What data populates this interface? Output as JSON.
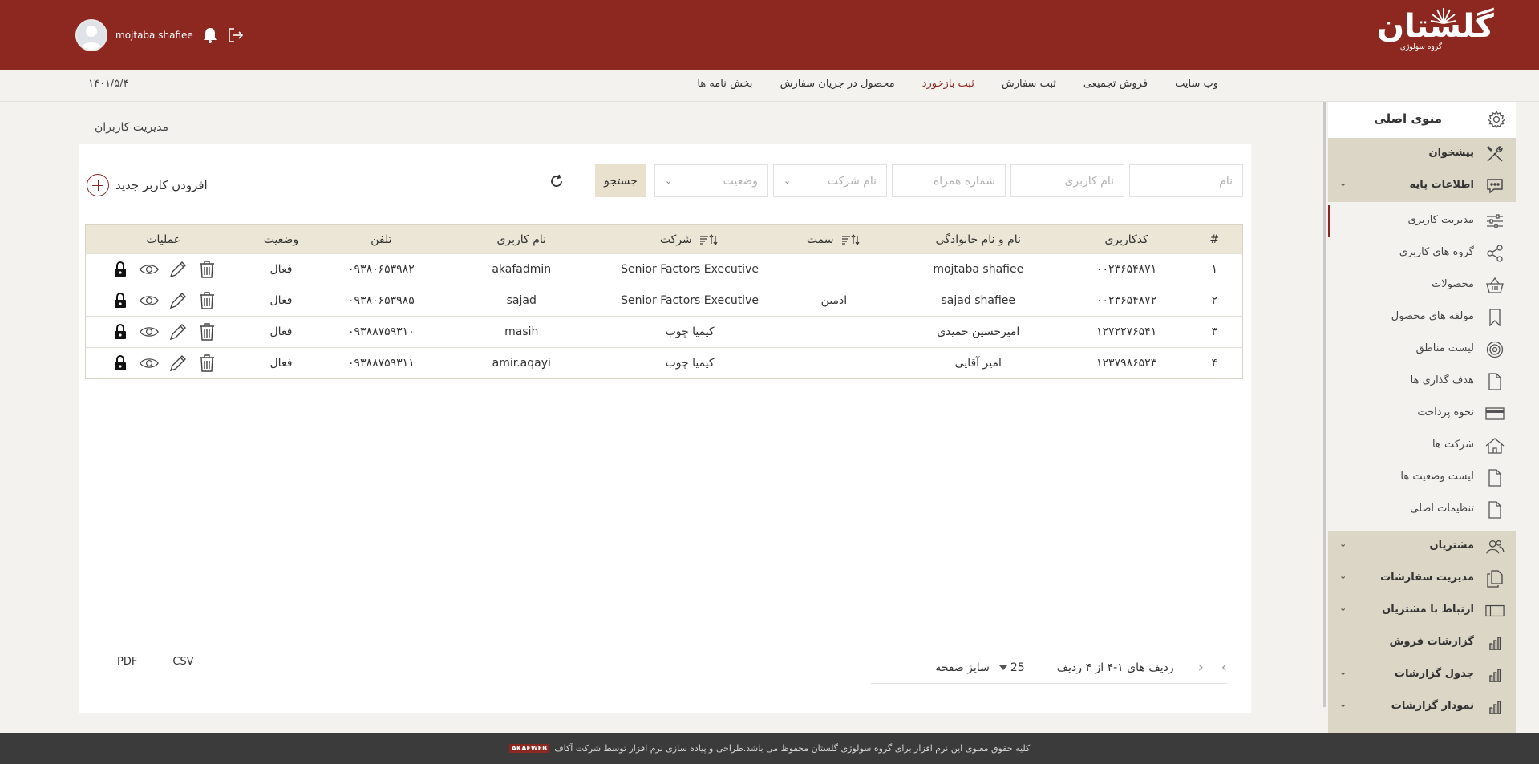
{
  "header": {
    "logo_text": "گلستان",
    "logo_sub": "گروه سولوژی",
    "user_name": "mojtaba shafiee"
  },
  "subnav": {
    "date": "۱۴۰۱/۵/۴",
    "links": [
      "وب سایت",
      "فروش تجمیعی",
      "ثبت سفارش",
      "ثبت بازخورد",
      "محصول در جریان سفارش",
      "بخش نامه ها"
    ],
    "active_link": "ثبت بازخورد"
  },
  "page": {
    "title": "مدیریت کاربران"
  },
  "filters": {
    "name_placeholder": "نام",
    "username_placeholder": "نام کاربری",
    "mobile_placeholder": "شماره همراه",
    "company_placeholder": "نام شرکت",
    "status_placeholder": "وضعیت",
    "search_label": "جستجو",
    "add_user_label": "افزودن کاربر جدید"
  },
  "table": {
    "columns": [
      "#",
      "کدکاربری",
      "نام و نام خانوادگی",
      "سمت",
      "شرکت",
      "نام کاربری",
      "تلفن",
      "وضعیت",
      "عملیات"
    ],
    "rows": [
      {
        "idx": "۱",
        "code": "۰۰۲۳۶۵۴۸۷۱",
        "name": "mojtaba shafiee",
        "role": "",
        "company": "Senior Factors Executive",
        "username": "akafadmin",
        "phone": "۰۹۳۸۰۶۵۳۹۸۲",
        "status": "فعال"
      },
      {
        "idx": "۲",
        "code": "۰۰۲۳۶۵۴۸۷۲",
        "name": "sajad shafiee",
        "role": "ادمین",
        "company": "Senior Factors Executive",
        "username": "sajad",
        "phone": "۰۹۳۸۰۶۵۳۹۸۵",
        "status": "فعال"
      },
      {
        "idx": "۳",
        "code": "۱۲۷۲۲۷۶۵۴۱",
        "name": "امیرحسین حمیدی",
        "role": "",
        "company": "کیمیا چوب",
        "username": "masih",
        "phone": "۰۹۳۸۸۷۵۹۳۱۰",
        "status": "فعال"
      },
      {
        "idx": "۴",
        "code": "۱۲۳۷۹۸۶۵۲۳",
        "name": "امیر آقایی",
        "role": "",
        "company": "کیمیا چوب",
        "username": "amir.aqayi",
        "phone": "۰۹۳۸۸۷۵۹۳۱۱",
        "status": "فعال"
      }
    ]
  },
  "pager": {
    "range_text": "ردیف های ۱-۴ از ۴ ردیف",
    "page_size": "25",
    "page_size_label": "سایز صفحه"
  },
  "export": {
    "pdf": "PDF",
    "csv": "CSV"
  },
  "sidebar": {
    "title": "منوی اصلی",
    "top_items": [
      {
        "label": "پیشخوان",
        "icon": "tools-icon"
      },
      {
        "label": "اطلاعات پایه",
        "icon": "chat-icon"
      }
    ],
    "sub_items": [
      {
        "label": "مدیریت کاربری",
        "icon": "sliders-icon"
      },
      {
        "label": "گروه های کاربری",
        "icon": "share-icon"
      },
      {
        "label": "محصولات",
        "icon": "basket-icon"
      },
      {
        "label": "مولفه های محصول",
        "icon": "bookmark-icon"
      },
      {
        "label": "لیست مناطق",
        "icon": "target-icon"
      },
      {
        "label": "هدف گذاری ها",
        "icon": "file-icon"
      },
      {
        "label": "نحوه پرداخت",
        "icon": "card-icon"
      },
      {
        "label": "شرکت ها",
        "icon": "home-icon"
      },
      {
        "label": "لیست وضعیت ها",
        "icon": "file-icon"
      },
      {
        "label": "تنظیمات اصلی",
        "icon": "file-icon"
      }
    ],
    "bottom_items": [
      {
        "label": "مشتریان",
        "icon": "users-icon"
      },
      {
        "label": "مدیریت سفارشات",
        "icon": "copy-icon"
      },
      {
        "label": "ارتباط با مشتریان",
        "icon": "crm-icon"
      },
      {
        "label": "گزارشات فروش",
        "icon": "bar-chart-icon"
      },
      {
        "label": "جدول گزارشات",
        "icon": "bar-chart-icon"
      },
      {
        "label": "نمودار گزارشات",
        "icon": "bar-chart-icon"
      }
    ]
  },
  "footer": {
    "text": "کلیه حقوق معنوی این نرم افزار برای گروه سولوژی گلستان محفوظ می باشد.طراحی و پیاده سازی نرم افزار توسط شرکت آکاف",
    "badge": "AKAFWEB"
  },
  "colors": {
    "brand": "#8c2820",
    "sidebar_bg": "#dcd6c6",
    "table_header": "#ece6d6",
    "footer": "#3b3b3b"
  }
}
